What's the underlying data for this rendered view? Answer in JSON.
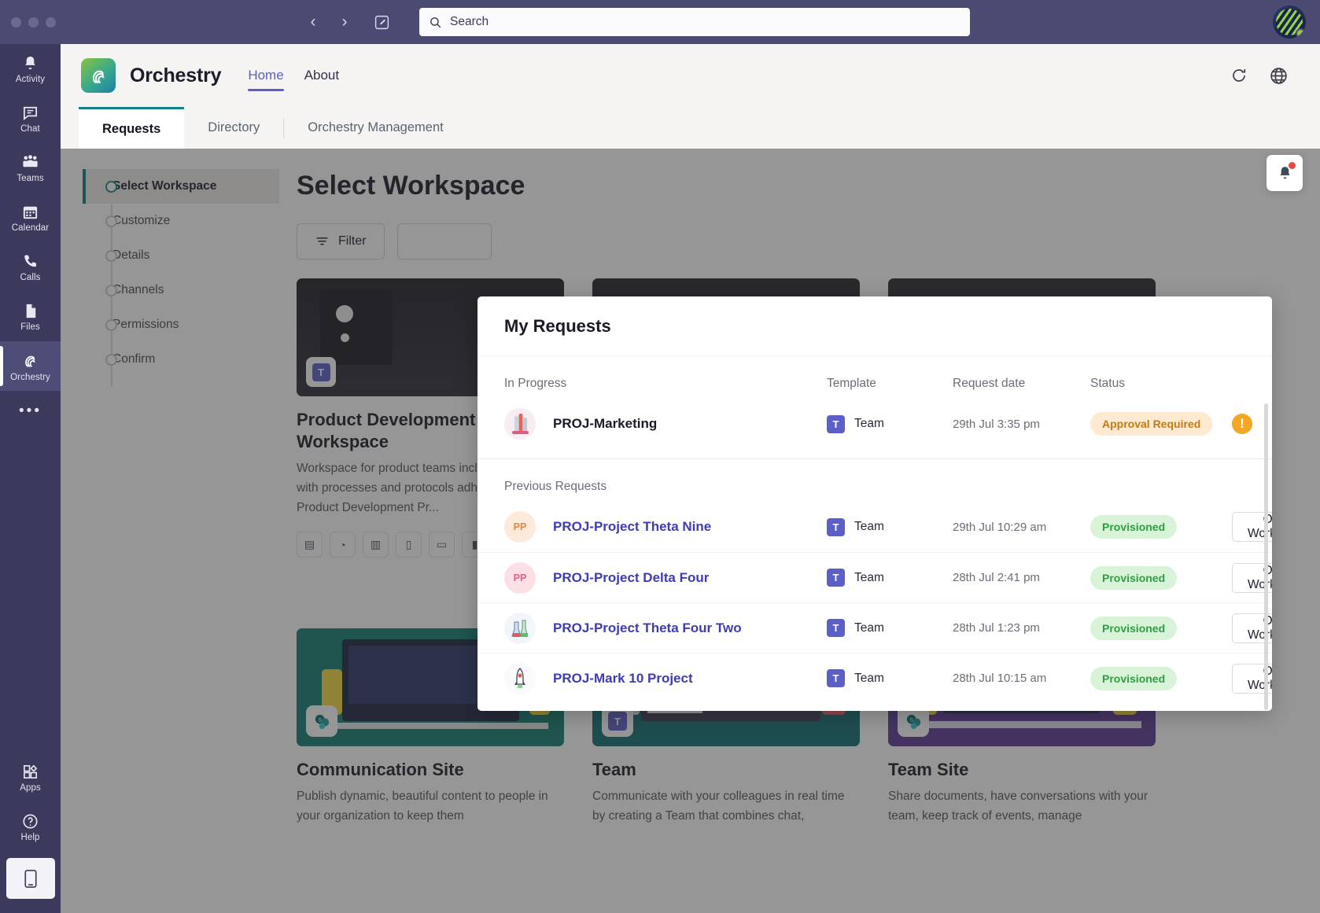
{
  "titlebar": {
    "search_placeholder": "Search",
    "back_icon": "chevron-left-icon",
    "forward_icon": "chevron-right-icon",
    "compose_icon": "compose-icon",
    "search_icon": "search-icon"
  },
  "rail": {
    "items": [
      {
        "label": "Activity",
        "icon": "bell-icon",
        "active": false
      },
      {
        "label": "Chat",
        "icon": "chat-icon",
        "active": false
      },
      {
        "label": "Teams",
        "icon": "teams-icon",
        "active": false
      },
      {
        "label": "Calendar",
        "icon": "calendar-icon",
        "active": false
      },
      {
        "label": "Calls",
        "icon": "phone-icon",
        "active": false
      },
      {
        "label": "Files",
        "icon": "file-icon",
        "active": false
      },
      {
        "label": "Orchestry",
        "icon": "orchestry-icon",
        "active": true
      }
    ],
    "more_label": "•••",
    "bottom_items": [
      {
        "label": "Apps",
        "icon": "apps-icon"
      },
      {
        "label": "Help",
        "icon": "help-icon"
      }
    ],
    "download_icon": "mobile-device-icon"
  },
  "apphead": {
    "app_name": "Orchestry",
    "logo_icon": "orchestry-logo-icon",
    "tabs": [
      {
        "label": "Home",
        "active": true
      },
      {
        "label": "About",
        "active": false
      }
    ],
    "refresh_icon": "refresh-icon",
    "globe_icon": "globe-icon"
  },
  "pagetabs": [
    {
      "label": "Requests",
      "active": true
    },
    {
      "label": "Directory",
      "active": false
    },
    {
      "label": "Orchestry Management",
      "active": false
    }
  ],
  "notification": {
    "icon": "bell-icon",
    "has_unread": true
  },
  "wizard": {
    "steps": [
      {
        "label": "Select Workspace",
        "active": true
      },
      {
        "label": "Customize",
        "active": false
      },
      {
        "label": "Details",
        "active": false
      },
      {
        "label": "Channels",
        "active": false
      },
      {
        "label": "Permissions",
        "active": false
      },
      {
        "label": "Confirm",
        "active": false
      }
    ]
  },
  "page": {
    "title": "Select Workspace",
    "filter_label": "Filter",
    "filter_icon": "filter-icon"
  },
  "templates": [
    {
      "title": "Product Development Workspace",
      "desc": "Workspace for product teams including R&D, with processes and protocols adhering to the Product Development Pr...",
      "badge_icon": "teams-icon",
      "pills": [
        "calendar-icon",
        "clock-icon",
        "building-icon",
        "doc-icon",
        "video-icon",
        "list-icon"
      ]
    },
    {
      "title": "",
      "desc": "",
      "badge_icon": "teams-icon",
      "pills": [
        "calendar-icon",
        "pie-icon",
        "clock-icon",
        "map-icon",
        "link-icon",
        "chart-icon",
        "list-icon"
      ]
    },
    {
      "title": "",
      "desc": "",
      "badge_icon": "teams-icon",
      "pills": [
        "map-icon",
        "window-icon",
        "yammer-icon"
      ]
    }
  ],
  "cards": [
    {
      "title": "Communication Site",
      "desc": "Publish dynamic, beautiful content to people in your organization to keep them",
      "badge_icon": "sharepoint-icon",
      "color": "#117b70"
    },
    {
      "title": "Team",
      "desc": "Communicate with your colleagues in real time by creating a Team that combines chat,",
      "badge_icon": "teams-icon",
      "color": "#0e6d73"
    },
    {
      "title": "Team Site",
      "desc": "Share documents, have conversations with your team, keep track of events, manage",
      "badge_icon": "sharepoint-icon",
      "color": "#5b3894"
    }
  ],
  "modal": {
    "title": "My Requests",
    "columns": {
      "name": "In Progress",
      "template": "Template",
      "date": "Request date",
      "status": "Status"
    },
    "previous_label": "Previous Requests",
    "in_progress": [
      {
        "name": "PROJ-Marketing",
        "template": "Team",
        "template_icon": "teams-icon",
        "date": "29th Jul 3:35 pm",
        "status": "Approval Required",
        "status_kind": "warn",
        "avatar_kind": "image-lipstick",
        "alert_icon": "alert-icon"
      }
    ],
    "previous": [
      {
        "name": "PROJ-Project Theta Nine",
        "template": "Team",
        "template_icon": "teams-icon",
        "date": "29th Jul 10:29 am",
        "status": "Provisioned",
        "status_kind": "ok",
        "avatar_kind": "initials",
        "avatar_text": "PP",
        "avatar_bg": "#fdeadb",
        "avatar_fg": "#e08a4e",
        "action": "Open Workspace"
      },
      {
        "name": "PROJ-Project Delta Four",
        "template": "Team",
        "template_icon": "teams-icon",
        "date": "28th Jul 2:41 pm",
        "status": "Provisioned",
        "status_kind": "ok",
        "avatar_kind": "initials",
        "avatar_text": "PP",
        "avatar_bg": "#fde0e6",
        "avatar_fg": "#e2607f",
        "action": "Open Workspace"
      },
      {
        "name": "PROJ-Project Theta Four Two",
        "template": "Team",
        "template_icon": "teams-icon",
        "date": "28th Jul 1:23 pm",
        "status": "Provisioned",
        "status_kind": "ok",
        "avatar_kind": "image-lab",
        "action": "Open Workspace"
      },
      {
        "name": "PROJ-Mark 10 Project",
        "template": "Team",
        "template_icon": "teams-icon",
        "date": "28th Jul 10:15 am",
        "status": "Provisioned",
        "status_kind": "ok",
        "avatar_kind": "image-rocket",
        "action": "Open Workspace"
      }
    ]
  },
  "colors": {
    "teams_purple": "#4b4a72",
    "accent": "#5b5fc7",
    "teal": "#14808a",
    "warn": "#f5a623",
    "ok": "#2f9e43"
  }
}
